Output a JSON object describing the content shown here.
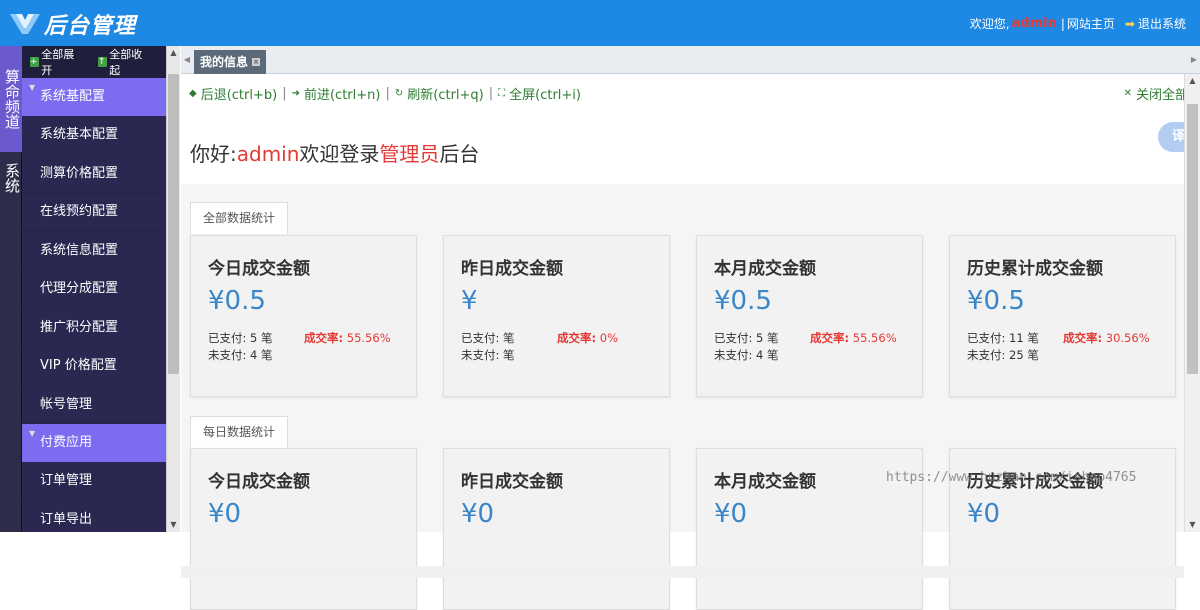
{
  "header": {
    "app_title": "后台管理",
    "welcome_text": "欢迎您,",
    "username": "admin",
    "separator": "|",
    "site_home": "网站主页",
    "logout": "退出系统"
  },
  "nav_tabs": [
    {
      "label": "算命频道"
    },
    {
      "label": "系统"
    }
  ],
  "sidebar": {
    "expand_all": "全部展开",
    "collapse_all": "全部收起",
    "groups": [
      {
        "label": "系统基配置",
        "items": [
          "系统基本配置",
          "测算价格配置",
          "在线预约配置",
          "系统信息配置",
          "代理分成配置",
          "推广积分配置",
          "VIP 价格配置",
          "帐号管理"
        ]
      },
      {
        "label": "付费应用",
        "items": [
          "订单管理",
          "订单导出"
        ]
      }
    ]
  },
  "tabs": {
    "active": "我的信息",
    "toolbar": {
      "back": "后退(ctrl+b)",
      "forward": "前进(ctrl+n)",
      "refresh": "刷新(ctrl+q)",
      "fullscreen": "全屏(ctrl+i)",
      "close_all": "关闭全部",
      "sep": "|"
    }
  },
  "translate_btn": "译",
  "welcome": {
    "hello": "你好:",
    "user": "admin",
    "mid": "欢迎登录",
    "role": "管理员",
    "end": "后台"
  },
  "sections": [
    {
      "tab": "全部数据统计",
      "cards": [
        {
          "title": "今日成交金额",
          "value": "¥0.5",
          "paid": "已支付: 5 笔",
          "unpaid": "未支付: 4 笔",
          "rate_label": "成交率:",
          "rate": "55.56%"
        },
        {
          "title": "昨日成交金额",
          "value": "¥",
          "paid": "已支付: 笔",
          "unpaid": "未支付: 笔",
          "rate_label": "成交率:",
          "rate": "0%"
        },
        {
          "title": "本月成交金额",
          "value": "¥0.5",
          "paid": "已支付: 5 笔",
          "unpaid": "未支付: 4 笔",
          "rate_label": "成交率:",
          "rate": "55.56%"
        },
        {
          "title": "历史累计成交金额",
          "value": "¥0.5",
          "paid": "已支付: 11 笔",
          "unpaid": "未支付: 25 笔",
          "rate_label": "成交率:",
          "rate": "30.56%"
        }
      ]
    },
    {
      "tab": "每日数据统计",
      "cards": [
        {
          "title": "今日成交金额",
          "value": "¥0"
        },
        {
          "title": "昨日成交金额",
          "value": "¥0"
        },
        {
          "title": "本月成交金额",
          "value": "¥0"
        },
        {
          "title": "历史累计成交金额",
          "value": "¥0"
        }
      ]
    }
  ],
  "watermark": "https://www.huzhan.com/ishop4765",
  "colors": {
    "header": "#1e88e5",
    "sidebar": "#2a2850",
    "group": "#7b6cf0",
    "accent_red": "#e53935",
    "value_blue": "#3a86c8"
  }
}
